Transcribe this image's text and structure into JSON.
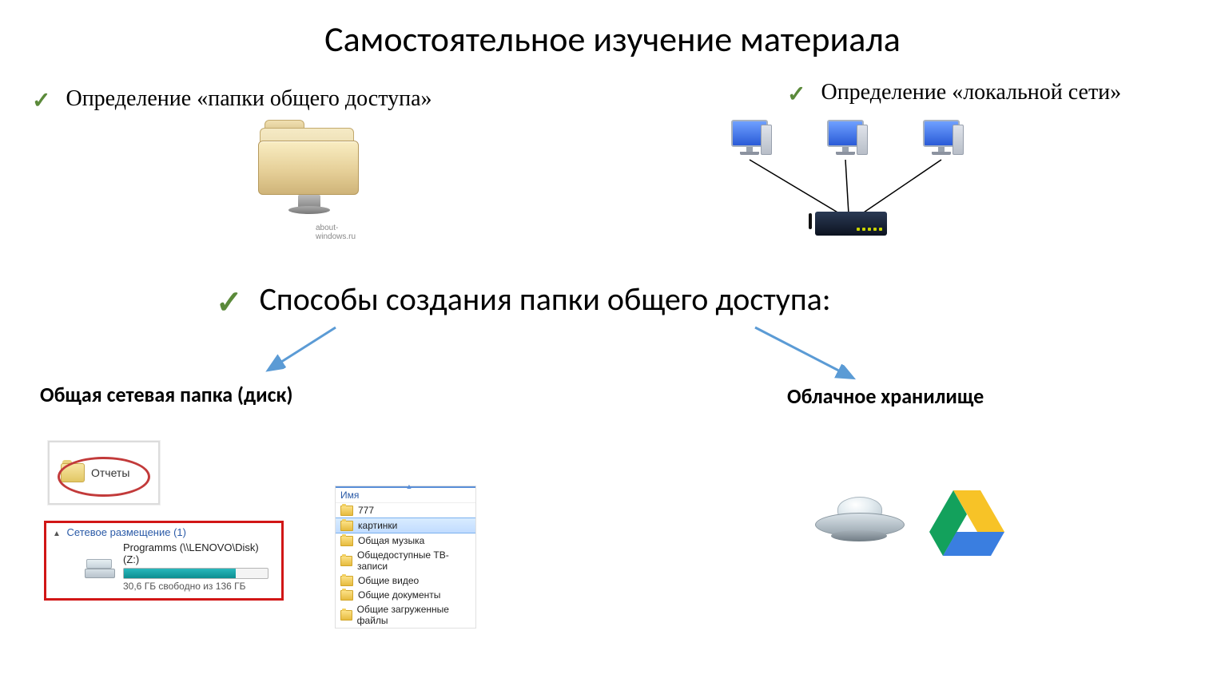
{
  "title": "Самостоятельное изучение материала",
  "bullets": {
    "left": "Определение «папки общего доступа»",
    "right": "Определение «локальной сети»",
    "middle": "Способы создания папки общего доступа:"
  },
  "folder_credit": "about-windows.ru",
  "subheadings": {
    "left": "Общая сетевая папка (диск)",
    "right": "Облачное хранилище"
  },
  "reports_label": "Отчеты",
  "netloc": {
    "header": "Сетевое размещение (1)",
    "drive_label": "Programms (\\\\LENOVO\\Disk) (Z:)",
    "free_text": "30,6 ГБ свободно из 136 ГБ"
  },
  "explorer": {
    "column": "Имя",
    "items": [
      {
        "name": "777",
        "selected": false
      },
      {
        "name": "картинки",
        "selected": true
      },
      {
        "name": "Общая музыка",
        "selected": false
      },
      {
        "name": "Общедоступные ТВ-записи",
        "selected": false
      },
      {
        "name": "Общие видео",
        "selected": false
      },
      {
        "name": "Общие документы",
        "selected": false
      },
      {
        "name": "Общие загруженные файлы",
        "selected": false
      }
    ]
  }
}
